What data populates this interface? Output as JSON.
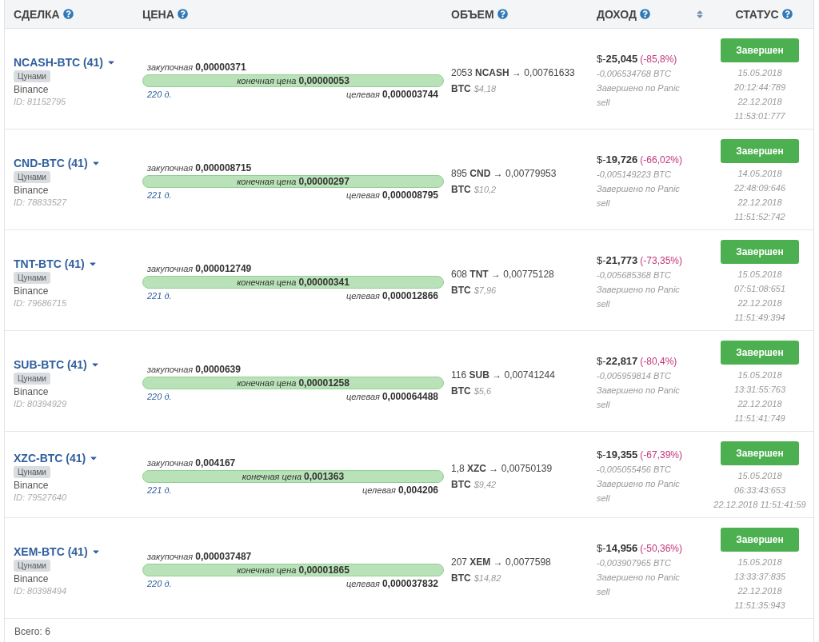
{
  "columns": [
    {
      "label": "СДЕЛКА",
      "help": true,
      "sortable": false
    },
    {
      "label": "ЦЕНА",
      "help": true,
      "sortable": false
    },
    {
      "label": "ОБЪЕМ",
      "help": true,
      "sortable": false
    },
    {
      "label": "ДОХОД",
      "help": true,
      "sortable": true
    },
    {
      "label": "СТАТУС",
      "help": true,
      "sortable": false
    }
  ],
  "rows": [
    {
      "pair": "NCASH-BTC (41)",
      "tag": "Цунами",
      "exchange": "Binance",
      "id": "ID: 81152795",
      "buy_label": "закупочная",
      "buy": "0,00000371",
      "final_label": "конечная цена",
      "final": "0,00000053",
      "days": "220 д.",
      "target_label": "целевая",
      "target": "0,000003744",
      "volume": "2053 **NCASH** → 0,00761633 **BTC**",
      "volume_usd": "$4,18",
      "profit": "$-**25,045**",
      "percent": "(-85,8%)",
      "profit_btc": "-0,006534768 BTC",
      "note": "Завершено по Panic sell",
      "status": "Завершен",
      "dates": [
        "15.05.2018",
        "20:12:44:789",
        "22.12.2018",
        "11:53:01:777"
      ]
    },
    {
      "pair": "CND-BTC (41)",
      "tag": "Цунами",
      "exchange": "Binance",
      "id": "ID: 78833527",
      "buy_label": "закупочная",
      "buy": "0,000008715",
      "final_label": "конечная цена",
      "final": "0,00000297",
      "days": "221 д.",
      "target_label": "целевая",
      "target": "0,000008795",
      "volume": "895 **CND** → 0,00779953 **BTC**",
      "volume_usd": "$10,2",
      "profit": "$-**19,726**",
      "percent": "(-66,02%)",
      "profit_btc": "-0,005149223 BTC",
      "note": "Завершено по Panic sell",
      "status": "Завершен",
      "dates": [
        "14.05.2018",
        "22:48:09:646",
        "22.12.2018",
        "11:51:52:742"
      ]
    },
    {
      "pair": "TNT-BTC (41)",
      "tag": "Цунами",
      "exchange": "Binance",
      "id": "ID: 79686715",
      "buy_label": "закупочная",
      "buy": "0,000012749",
      "final_label": "конечная цена",
      "final": "0,00000341",
      "days": "221 д.",
      "target_label": "целевая",
      "target": "0,000012866",
      "volume": "608 **TNT** → 0,00775128 **BTC**",
      "volume_usd": "$7,96",
      "profit": "$-**21,773**",
      "percent": "(-73,35%)",
      "profit_btc": "-0,005685368 BTC",
      "note": "Завершено по Panic sell",
      "status": "Завершен",
      "dates": [
        "15.05.2018",
        "07:51:08:651",
        "22.12.2018",
        "11:51:49:394"
      ]
    },
    {
      "pair": "SUB-BTC (41)",
      "tag": "Цунами",
      "exchange": "Binance",
      "id": "ID: 80394929",
      "buy_label": "закупочная",
      "buy": "0,0000639",
      "final_label": "конечная цена",
      "final": "0,00001258",
      "days": "220 д.",
      "target_label": "целевая",
      "target": "0,000064488",
      "volume": "116 **SUB** → 0,00741244 **BTC**",
      "volume_usd": "$5,6",
      "profit": "$-**22,817**",
      "percent": "(-80,4%)",
      "profit_btc": "-0,005959814 BTC",
      "note": "Завершено по Panic sell",
      "status": "Завершен",
      "dates": [
        "15.05.2018",
        "13:31:55:763",
        "22.12.2018",
        "11:51:41:749"
      ]
    },
    {
      "pair": "XZC-BTC (41)",
      "tag": "Цунами",
      "exchange": "Binance",
      "id": "ID: 79527640",
      "buy_label": "закупочная",
      "buy": "0,004167",
      "final_label": "конечная цена",
      "final": "0,001363",
      "days": "221 д.",
      "target_label": "целевая",
      "target": "0,004206",
      "volume": "1,8 **XZC** → 0,00750139 **BTC**",
      "volume_usd": "$9,42",
      "profit": "$-**19,355**",
      "percent": "(-67,39%)",
      "profit_btc": "-0,005055456 BTC",
      "note": "Завершено по Panic sell",
      "status": "Завершен",
      "dates": [
        "15.05.2018",
        "06:33:43:653",
        "22.12.2018 11:51:41:59"
      ]
    },
    {
      "pair": "XEM-BTC (41)",
      "tag": "Цунами",
      "exchange": "Binance",
      "id": "ID: 80398494",
      "buy_label": "закупочная",
      "buy": "0,000037487",
      "final_label": "конечная цена",
      "final": "0,00001865",
      "days": "220 д.",
      "target_label": "целевая",
      "target": "0,000037832",
      "volume": "207 **XEM** → 0,0077598 **BTC**",
      "volume_usd": "$14,82",
      "profit": "$-**14,956**",
      "percent": "(-50,36%)",
      "profit_btc": "-0,003907965 BTC",
      "note": "Завершено по Panic sell",
      "status": "Завершен",
      "dates": [
        "15.05.2018",
        "13:33:37:835",
        "22.12.2018",
        "11:51:35:943"
      ]
    }
  ],
  "footer": "Всего: 6"
}
